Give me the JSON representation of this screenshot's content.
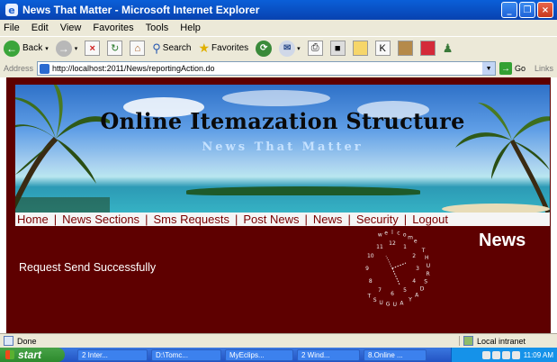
{
  "window": {
    "title": "News That Matter - Microsoft Internet Explorer",
    "buttons": [
      "_",
      "❐",
      "×"
    ]
  },
  "menu": [
    "File",
    "Edit",
    "View",
    "Favorites",
    "Tools",
    "Help"
  ],
  "toolbar": {
    "back": "Back",
    "search": "Search",
    "favorites": "Favorites"
  },
  "address": {
    "label": "Address",
    "url": "http://localhost:2011/News/reportingAction.do",
    "go": "Go",
    "links": "Links"
  },
  "site": {
    "title": "Online Itemazation Structure",
    "subtitle": "News That Matter",
    "nav": [
      "Home",
      "News Sections",
      "Sms Requests",
      "Post News",
      "News",
      "Security",
      "Logout"
    ],
    "headline": "News",
    "message": "Request Send Successfully",
    "clock_ring": "welcome",
    "clock_ring2": "THURSDAY",
    "clock_ring3": "AUGUST",
    "clock_numbers": [
      "12",
      "1",
      "2",
      "3",
      "4",
      "5",
      "6",
      "7",
      "8",
      "9",
      "10",
      "11"
    ]
  },
  "status": {
    "left": "Done",
    "zone": "Local intranet"
  },
  "taskbar": {
    "start": "start",
    "tasks": [
      "2 Inter...",
      "D:\\Tomc...",
      "MyEclips...",
      "2 Wind...",
      "8.Online ..."
    ],
    "time": "11:09 AM"
  }
}
